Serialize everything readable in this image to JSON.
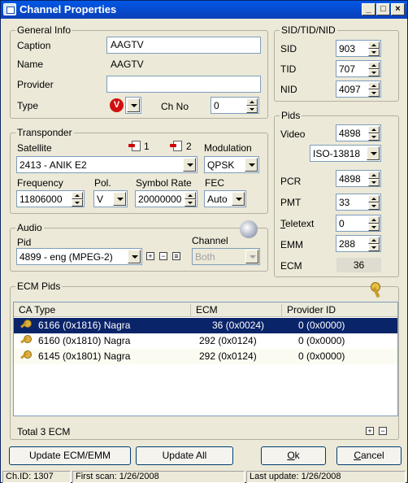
{
  "window": {
    "title": "Channel Properties"
  },
  "general": {
    "legend": "General Info",
    "caption_label": "Caption",
    "caption_value": "AAGTV",
    "name_label": "Name",
    "name_value": "AAGTV",
    "provider_label": "Provider",
    "provider_value": "",
    "type_label": "Type",
    "type_value": "V",
    "chno_label": "Ch No",
    "chno_value": "0"
  },
  "transponder": {
    "legend": "Transponder",
    "satellite_label": "Satellite",
    "sat1": "1",
    "sat2": "2",
    "satellite_value": "2413 - ANIK E2",
    "modulation_label": "Modulation",
    "modulation_value": "QPSK",
    "frequency_label": "Frequency",
    "frequency_value": "11806000",
    "pol_label": "Pol.",
    "pol_value": "V",
    "symbol_label": "Symbol Rate",
    "symbol_value": "20000000",
    "fec_label": "FEC",
    "fec_value": "Auto"
  },
  "audio": {
    "legend": "Audio",
    "pid_label": "Pid",
    "pid_value": "4899 - eng (MPEG-2)",
    "channel_label": "Channel",
    "channel_value": "Both"
  },
  "sid": {
    "legend": "SID/TID/NID",
    "sid_label": "SID",
    "sid_value": "903",
    "tid_label": "TID",
    "tid_value": "707",
    "nid_label": "NID",
    "nid_value": "4097"
  },
  "pids": {
    "legend": "Pids",
    "video_label": "Video",
    "video_value": "4898",
    "video_type": "ISO-13818",
    "pcr_label": "PCR",
    "pcr_value": "4898",
    "pmt_label": "PMT",
    "pmt_value": "33",
    "teletext_label_first": "T",
    "teletext_label_rest": "eletext",
    "teletext_value": "0",
    "emm_label": "EMM",
    "emm_value": "288",
    "ecm_label": "ECM",
    "ecm_value": "36"
  },
  "ecm": {
    "legend": "ECM Pids",
    "headers": {
      "ca": "CA Type",
      "ecm": "ECM",
      "prov": "Provider ID"
    },
    "rows": [
      {
        "ca": "6166  (0x1816) Nagra",
        "ecm": "36  (0x0024)",
        "prov": "0  (0x0000)"
      },
      {
        "ca": "6160  (0x1810) Nagra",
        "ecm": "292  (0x0124)",
        "prov": "0  (0x0000)"
      },
      {
        "ca": "6145  (0x1801) Nagra",
        "ecm": "292  (0x0124)",
        "prov": "0  (0x0000)"
      }
    ],
    "total": "Total 3 ECM"
  },
  "buttons": {
    "update_ecm": "Update ECM/EMM",
    "update_all": "Update All",
    "ok_first": "O",
    "ok_rest": "k",
    "cancel_first": "C",
    "cancel_rest": "ancel"
  },
  "status": {
    "chid": "Ch.ID: 1307",
    "first_scan": "First scan: 1/26/2008",
    "last_update": "Last update: 1/26/2008"
  }
}
